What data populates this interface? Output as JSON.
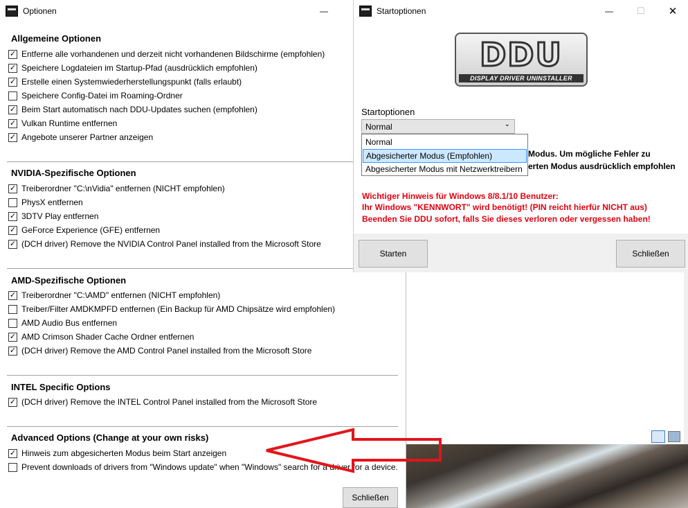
{
  "options_window": {
    "title": "Optionen",
    "minimize": "—",
    "close_label": "Schließen",
    "sections": [
      {
        "title": "Allgemeine Optionen",
        "items": [
          {
            "label": "Entferne alle vorhandenen und derzeit nicht vorhandenen Bildschirme (empfohlen)",
            "checked": true
          },
          {
            "label": "Speichere Logdateien im Startup-Pfad (ausdrücklich empfohlen)",
            "checked": true
          },
          {
            "label": "Erstelle einen Systemwiederherstellungspunkt (falls erlaubt)",
            "checked": true
          },
          {
            "label": "Speichere Config-Datei im Roaming-Ordner",
            "checked": false
          },
          {
            "label": "Beim Start automatisch nach DDU-Updates suchen (empfohlen)",
            "checked": true
          },
          {
            "label": "Vulkan Runtime entfernen",
            "checked": true
          },
          {
            "label": "Angebote unserer Partner anzeigen",
            "checked": true
          }
        ]
      },
      {
        "title": "NVIDIA-Spezifische Optionen",
        "items": [
          {
            "label": "Treiberordner \"C:\\nVidia\" entfernen (NICHT empfohlen)",
            "checked": true
          },
          {
            "label": "PhysX entfernen",
            "checked": false
          },
          {
            "label": "3DTV Play entfernen",
            "checked": true
          },
          {
            "label": "GeForce Experience (GFE) entfernen",
            "checked": true
          },
          {
            "label": "(DCH driver) Remove the NVIDIA Control Panel installed from the Microsoft Store",
            "checked": true
          }
        ]
      },
      {
        "title": "AMD-Spezifische Optionen",
        "items": [
          {
            "label": "Treiberordner \"C:\\AMD\" entfernen (NICHT empfohlen)",
            "checked": true
          },
          {
            "label": "Treiber/Filter AMDKMPFD entfernen (Ein Backup für AMD Chipsätze wird empfohlen)",
            "checked": false
          },
          {
            "label": "AMD Audio Bus entfernen",
            "checked": false
          },
          {
            "label": "AMD Crimson Shader Cache Ordner entfernen",
            "checked": true
          },
          {
            "label": "(DCH driver) Remove the AMD Control Panel installed from the Microsoft Store",
            "checked": true
          }
        ]
      },
      {
        "title": "INTEL Specific Options",
        "items": [
          {
            "label": "(DCH driver) Remove the INTEL Control Panel installed from the Microsoft Store",
            "checked": true
          }
        ]
      },
      {
        "title": "Advanced Options (Change at your own risks)",
        "items": [
          {
            "label": "Hinweis zum abgesicherten Modus beim Start anzeigen",
            "checked": true
          },
          {
            "label": "Prevent downloads of drivers from \"Windows update\" when \"Windows\" search for a driver for a device.",
            "checked": false
          }
        ]
      }
    ]
  },
  "startup_window": {
    "title": "Startoptionen",
    "minimize": "—",
    "maximize": "☐",
    "close": "✕",
    "logo_main": "DDU",
    "logo_sub": "DISPLAY DRIVER UNINSTALLER",
    "dropdown_label": "Startoptionen",
    "dropdown_value": "Normal",
    "dropdown_options": [
      "Normal",
      "Abgesicherter Modus (Empfohlen)",
      "Abgesicherter Modus mit Netzwerktreibern"
    ],
    "info_line1": "Modus. Um mögliche Fehler zu",
    "info_line2": "erten Modus ausdrücklich empfohlen",
    "warning": [
      "Wichtiger Hinweis für Windows 8/8.1/10 Benutzer:",
      "Ihr Windows \"KENNWORT\" wird benötigt! (PIN reicht hierfür NICHT aus)",
      "Beenden Sie DDU sofort, falls Sie dieses verloren oder vergessen haben!"
    ],
    "start_button": "Starten",
    "close_button": "Schließen"
  },
  "colors": {
    "warning": "#e0000f",
    "selection": "#cce8ff",
    "arrow": "#e4141b"
  }
}
